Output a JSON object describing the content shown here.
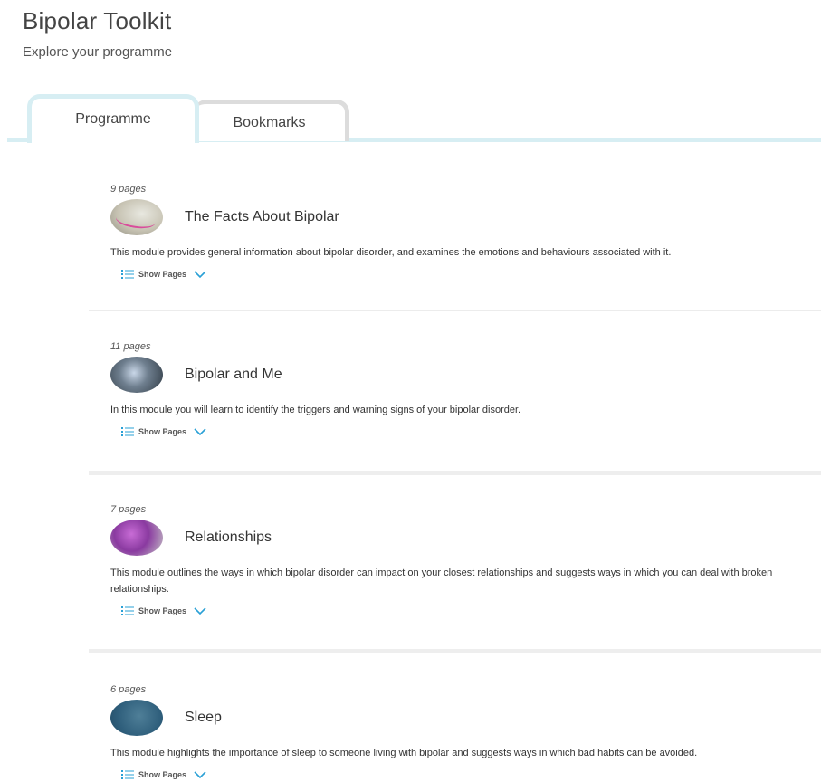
{
  "header": {
    "title": "Bipolar Toolkit",
    "subtitle": "Explore your programme"
  },
  "tabs": [
    {
      "label": "Programme",
      "active": true
    },
    {
      "label": "Bookmarks",
      "active": false
    }
  ],
  "colors": {
    "active_tab_border": "#d7eef3",
    "inactive_tab_border": "#dcdcdc",
    "accent": "#2aa0d6"
  },
  "show_pages_label": "Show Pages",
  "modules": [
    {
      "pages": "9 pages",
      "title": "The Facts About Bipolar",
      "description": "This module provides general information about bipolar disorder, and examines the emotions and behaviours associated with it."
    },
    {
      "pages": "11 pages",
      "title": "Bipolar and Me",
      "description": "In this module you will learn to identify the triggers and warning signs of your bipolar disorder."
    },
    {
      "pages": "7 pages",
      "title": "Relationships",
      "description": "This module outlines the ways in which bipolar disorder can impact on your closest relationships and suggests ways in which you can deal with broken relationships."
    },
    {
      "pages": "6 pages",
      "title": "Sleep",
      "description": "This module highlights the importance of sleep to someone living with bipolar and suggests ways in which bad habits can be avoided."
    }
  ]
}
